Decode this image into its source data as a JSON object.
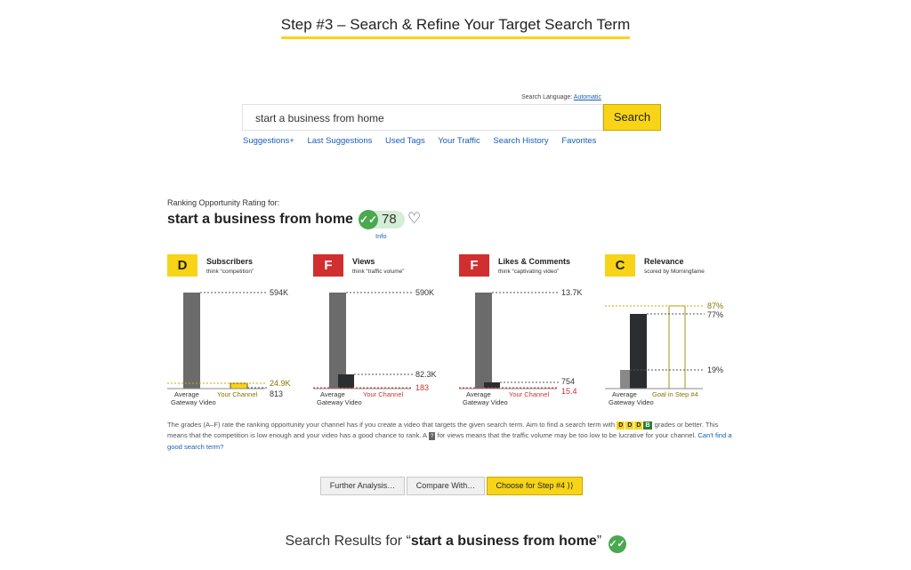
{
  "header": {
    "step_title": "Step #3 – Search & Refine Your Target Search Term"
  },
  "search": {
    "language_label": "Search Language:",
    "language_value": "Automatic",
    "query": "start a business from home",
    "button_label": "Search"
  },
  "links": [
    "Suggestions+",
    "Last Suggestions",
    "Used Tags",
    "Your Traffic",
    "Search History",
    "Favorites"
  ],
  "rating": {
    "label": "Ranking Opportunity Rating for:",
    "term": "start a business from home",
    "score": "78",
    "info": "Info"
  },
  "metrics": [
    {
      "grade": "D",
      "grade_color": "#f7d417",
      "title": "Subscribers",
      "subtitle": "think “competition”",
      "top_label": "594K",
      "mid_label": "24.9K",
      "low_label": "813",
      "x_left": "Average",
      "x_left2": "Gateway Video",
      "x_right": "Your Channel",
      "values": {
        "average": 594000,
        "target": 24900,
        "yours": 813
      }
    },
    {
      "grade": "F",
      "grade_color": "#d12f2f",
      "title": "Views",
      "subtitle": "think “traffic volume”",
      "top_label": "590K",
      "mid_label": "82.3K",
      "low_label": "183",
      "x_left": "Average",
      "x_left2": "Gateway Video",
      "x_right": "Your Channel",
      "values": {
        "average": 590000,
        "target": 82300,
        "yours": 183
      }
    },
    {
      "grade": "F",
      "grade_color": "#d12f2f",
      "title": "Likes & Comments",
      "subtitle": "think “captivating video”",
      "top_label": "13.7K",
      "mid_label": "754",
      "low_label": "15.4",
      "x_left": "Average",
      "x_left2": "Gateway Video",
      "x_right": "Your Channel",
      "values": {
        "average": 13700,
        "target": 754,
        "yours": 15.4
      }
    },
    {
      "grade": "C",
      "grade_color": "#f7d417",
      "title": "Relevance",
      "subtitle": "scored by Morningfame",
      "top_label": "87%",
      "mid_label": "77%",
      "low_label": "19%",
      "x_left": "Average",
      "x_left2": "Gateway Video",
      "x_right": "Goal in Step #4",
      "values": {
        "goal": 87,
        "gateway": 77,
        "average": 19
      }
    }
  ],
  "note": {
    "part1": "The grades (A–F) rate the ranking opportunity your channel has if you create a video that targets the given search term. Aim to find a search term with",
    "grades": [
      "D",
      "D",
      "D",
      "B"
    ],
    "part2": "grades or better. This means that the competition is low enough and your video has a good chance to rank. A",
    "q": "?",
    "part3": "for views means that the traffic volume may be too low to be lucrative for your channel.",
    "link": "Can't find a good search term?"
  },
  "buttons": {
    "further": "Further Analysis…",
    "compare": "Compare With…",
    "choose": "Choose for Step #4 ⟩⟩"
  },
  "results": {
    "prefix": "Search Results for “",
    "term": "start a business from home",
    "suffix": "”"
  },
  "colors": {
    "accent": "#f7d417",
    "grade_red": "#d12f2f",
    "check_green": "#4aa84e",
    "link": "#1a5fb4"
  }
}
